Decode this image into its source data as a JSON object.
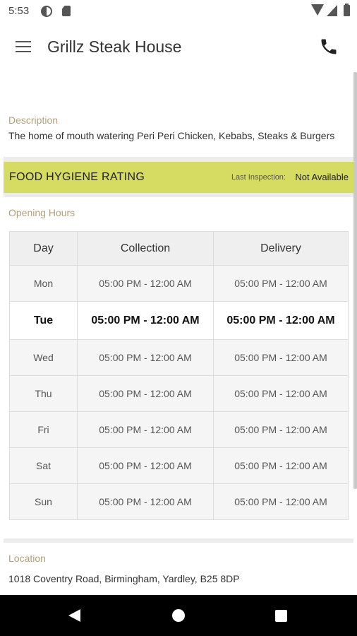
{
  "status": {
    "time": "5:53"
  },
  "app": {
    "title": "Grillz Steak House"
  },
  "description": {
    "label": "Description",
    "text": "The home of mouth watering Peri Peri Chicken, Kebabs, Steaks & Burgers"
  },
  "hygiene": {
    "title": "FOOD HYGIENE RATING",
    "last_label": "Last Inspection:",
    "last_value": "Not Available",
    "color": "#d6db61"
  },
  "hours": {
    "label": "Opening Hours",
    "headers": [
      "Day",
      "Collection",
      "Delivery"
    ],
    "rows": [
      {
        "day": "Mon",
        "collection": "05:00 PM - 12:00 AM",
        "delivery": "05:00 PM - 12:00 AM"
      },
      {
        "day": "Tue",
        "collection": "05:00 PM - 12:00 AM",
        "delivery": "05:00 PM - 12:00 AM",
        "today": true
      },
      {
        "day": "Wed",
        "collection": "05:00 PM - 12:00 AM",
        "delivery": "05:00 PM - 12:00 AM"
      },
      {
        "day": "Thu",
        "collection": "05:00 PM - 12:00 AM",
        "delivery": "05:00 PM - 12:00 AM"
      },
      {
        "day": "Fri",
        "collection": "05:00 PM - 12:00 AM",
        "delivery": "05:00 PM - 12:00 AM"
      },
      {
        "day": "Sat",
        "collection": "05:00 PM - 12:00 AM",
        "delivery": "05:00 PM - 12:00 AM"
      },
      {
        "day": "Sun",
        "collection": "05:00 PM - 12:00 AM",
        "delivery": "05:00 PM - 12:00 AM"
      }
    ]
  },
  "location": {
    "label": "Location",
    "address": "1018 Coventry Road, Birmingham, Yardley, B25 8DP"
  },
  "icons": [
    "menu-icon",
    "phone-icon",
    "back-icon",
    "home-icon",
    "recents-icon"
  ],
  "colors": {
    "accent_label": "#b3a07a",
    "hygiene_band": "#d6db61"
  }
}
